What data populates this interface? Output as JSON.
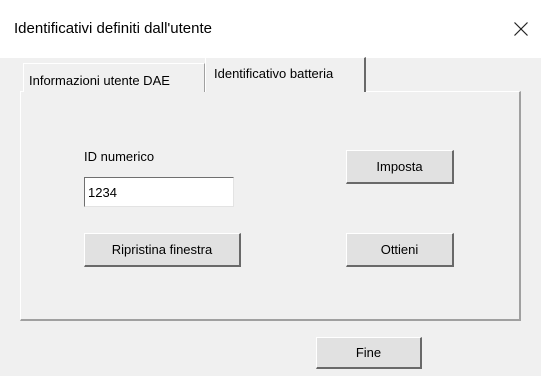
{
  "window": {
    "title": "Identificativi definiti dall'utente",
    "close_icon": "close-icon"
  },
  "tabs": [
    {
      "label": "Informazioni utente DAE",
      "selected": false
    },
    {
      "label": "Identificativo batteria",
      "selected": true
    }
  ],
  "form": {
    "id_label": "ID numerico",
    "id_value": "1234",
    "set_label": "Imposta",
    "restore_label": "Ripristina finestra",
    "get_label": "Ottieni"
  },
  "footer": {
    "done_label": "Fine"
  }
}
